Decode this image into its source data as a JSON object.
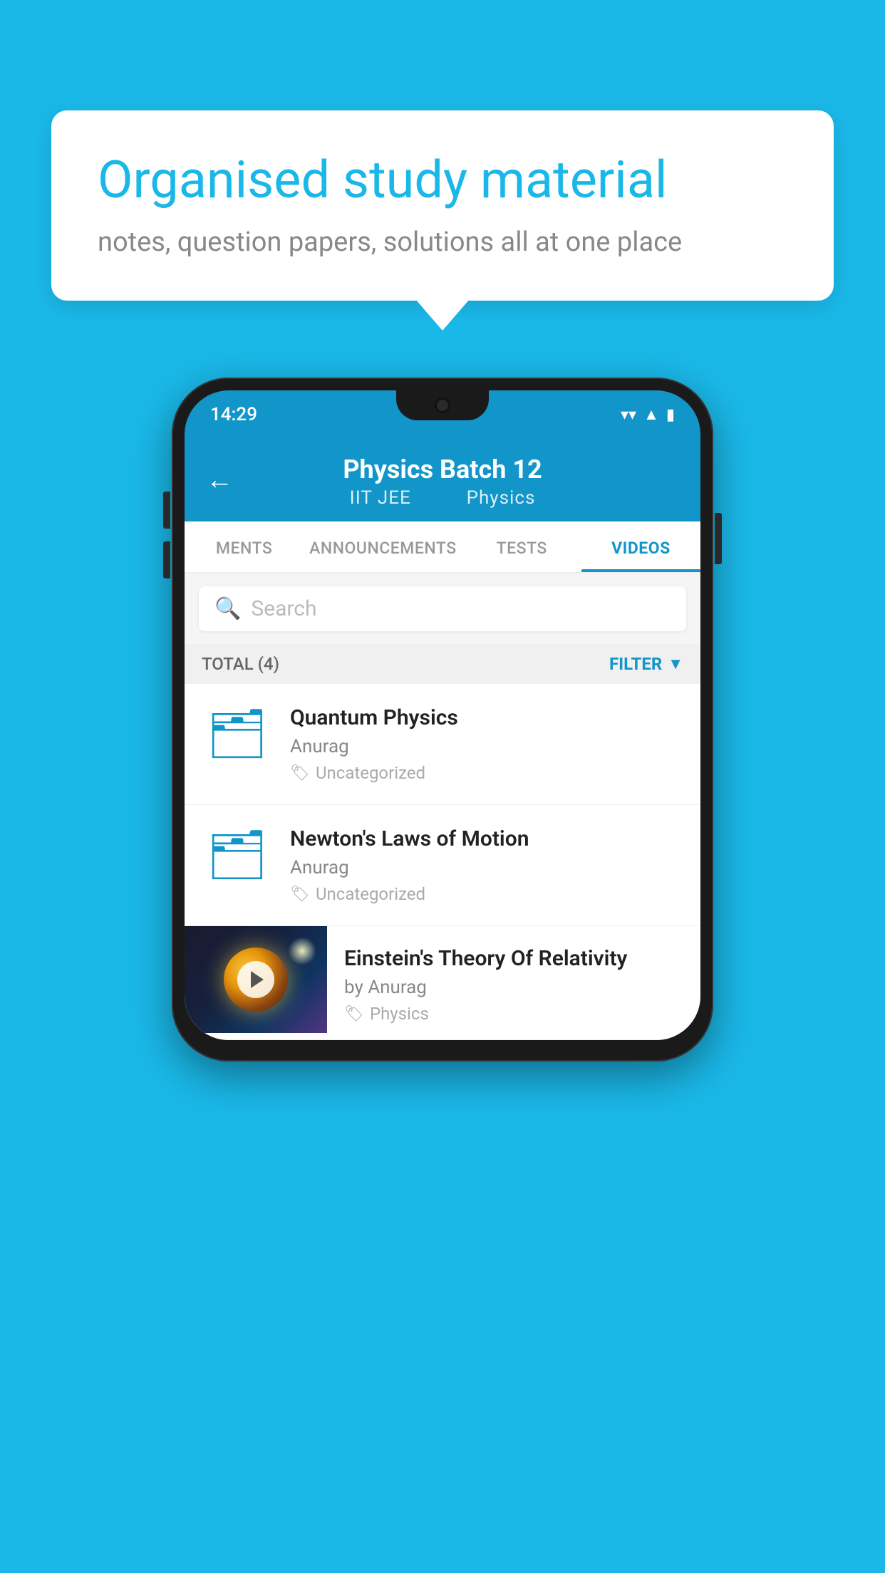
{
  "background": {
    "color": "#1ab8e8"
  },
  "speech_bubble": {
    "title": "Organised study material",
    "subtitle": "notes, question papers, solutions all at one place"
  },
  "phone": {
    "status_bar": {
      "time": "14:29"
    },
    "header": {
      "title": "Physics Batch 12",
      "subtitle_part1": "IIT JEE",
      "subtitle_part2": "Physics",
      "back_label": "←"
    },
    "tabs": [
      {
        "label": "MENTS",
        "active": false
      },
      {
        "label": "ANNOUNCEMENTS",
        "active": false
      },
      {
        "label": "TESTS",
        "active": false
      },
      {
        "label": "VIDEOS",
        "active": true
      }
    ],
    "search": {
      "placeholder": "Search"
    },
    "filter": {
      "total_label": "TOTAL (4)",
      "filter_label": "FILTER"
    },
    "videos": [
      {
        "id": 1,
        "title": "Quantum Physics",
        "author": "Anurag",
        "tag": "Uncategorized",
        "type": "folder"
      },
      {
        "id": 2,
        "title": "Newton's Laws of Motion",
        "author": "Anurag",
        "tag": "Uncategorized",
        "type": "folder"
      },
      {
        "id": 3,
        "title": "Einstein's Theory Of Relativity",
        "author": "by Anurag",
        "tag": "Physics",
        "type": "video"
      }
    ]
  }
}
